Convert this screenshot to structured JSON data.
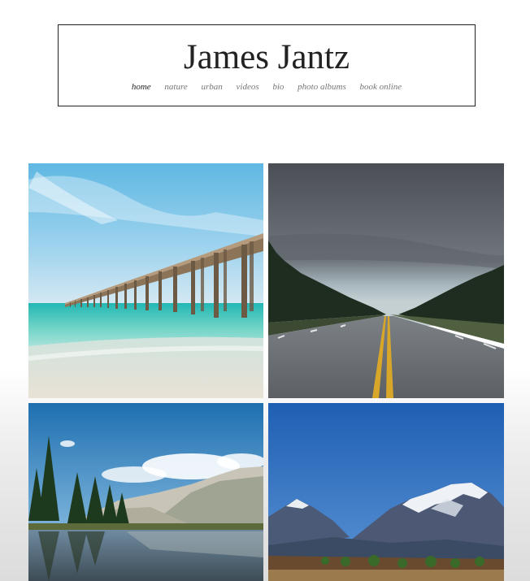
{
  "site": {
    "title": "James Jantz"
  },
  "nav": {
    "items": [
      {
        "label": "home",
        "active": true
      },
      {
        "label": "nature"
      },
      {
        "label": "urban"
      },
      {
        "label": "videos"
      },
      {
        "label": "bio"
      },
      {
        "label": "photo albums"
      },
      {
        "label": "book online"
      }
    ]
  },
  "gallery": {
    "photos": [
      {
        "subject": "wooden pier over turquoise sea"
      },
      {
        "subject": "empty highway through pine forest under grey sky"
      },
      {
        "subject": "alpine lake with pine trees and granite mountains"
      },
      {
        "subject": "snow-capped mountains under blue sky"
      }
    ]
  },
  "colors": {
    "text": "#222222",
    "nav": "#777777",
    "border": "#222222"
  }
}
